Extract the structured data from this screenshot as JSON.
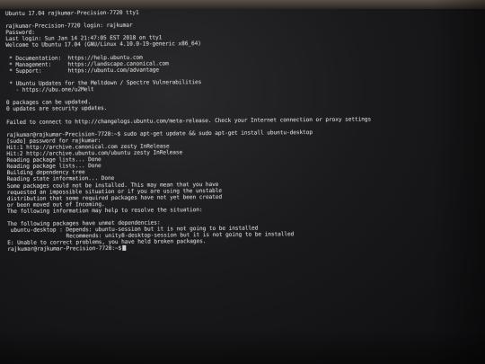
{
  "terminal": {
    "lines": [
      "Ubuntu 17.04 rajkumar-Precision-7720 tty1",
      "",
      "rajkumar-Precision-7720 login: rajkumar",
      "Password:",
      "Last login: Sun Jan 14 21:47:05 EST 2018 on tty1",
      "Welcome to Ubuntu 17.04 (GNU/Linux 4.10.0-19-generic x86_64)",
      "",
      " * Documentation:  https://help.ubuntu.com",
      " * Management:     https://landscape.canonical.com",
      " * Support:        https://ubuntu.com/advantage",
      "",
      " * Ubuntu Updates for the Meltdown / Spectre Vulnerabilities",
      "   - https://ubu.one/u2Melt",
      "",
      "0 packages can be updated.",
      "0 updates are security updates.",
      "",
      "Failed to connect to http://changelogs.ubuntu.com/meta-release. Check your Internet connection or proxy settings",
      "",
      "rajkumar@rajkumar-Precision-7720:~$ sudo apt-get update && sudo apt-get install ubuntu-desktop",
      "[sudo] password for rajkumar:",
      "Hit:1 http://archive.canonical.com zesty InRelease",
      "Hit:2 http://archive.ubuntu.com/ubuntu zesty InRelease",
      "Reading package lists... Done",
      "Reading package lists... Done",
      "Building dependency tree",
      "Reading state information... Done",
      "Some packages could not be installed. This may mean that you have",
      "requested an impossible situation or if you are using the unstable",
      "distribution that some required packages have not yet been created",
      "or been moved out of Incoming.",
      "The following information may help to resolve the situation:",
      "",
      "The following packages have unmet dependencies:",
      " ubuntu-desktop : Depends: ubuntu-session but it is not going to be installed",
      "                  Recommends: unity8-desktop-session but it is not going to be installed",
      "E: Unable to correct problems, you have held broken packages.",
      "rajkumar@rajkumar-Precision-7720:~$"
    ]
  }
}
